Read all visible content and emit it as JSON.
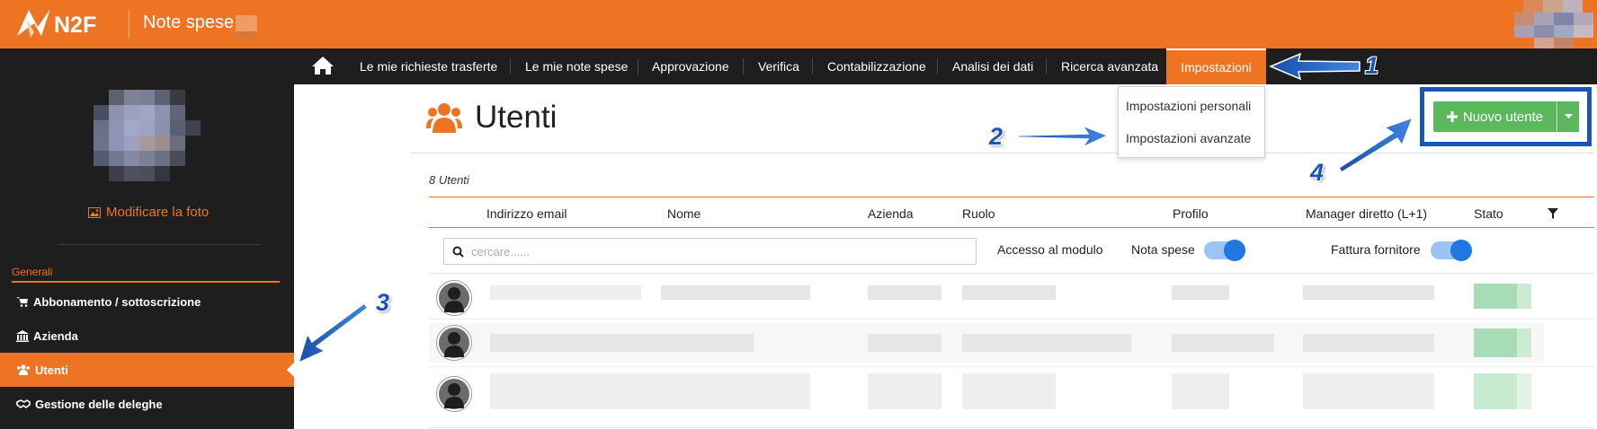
{
  "header": {
    "logo_text": "N2F",
    "app_title": "Note spese",
    "brand_color": "#ee7424"
  },
  "nav": {
    "home_icon": "home-icon",
    "items": [
      "Le mie richieste trasferte",
      "Le mie note spese",
      "Approvazione",
      "Verifica",
      "Contabilizzazione",
      "Analisi dei dati",
      "Ricerca avanzata",
      "Impostazioni"
    ],
    "active": "Impostazioni"
  },
  "settings_dropdown": {
    "items": [
      "Impostazioni personali",
      "Impostazioni avanzate"
    ]
  },
  "sidebar": {
    "change_photo": "Modificare la foto",
    "section": "Generali",
    "items": [
      {
        "label": "Abbonamento / sottoscrizione",
        "icon": "cart-icon"
      },
      {
        "label": "Azienda",
        "icon": "bank-icon"
      },
      {
        "label": "Utenti",
        "icon": "users-icon",
        "active": true
      },
      {
        "label": "Gestione delle deleghe",
        "icon": "handshake-icon"
      }
    ]
  },
  "main": {
    "title": "Utenti",
    "count_label": "8 Utenti",
    "new_user_button": "Nuovo utente",
    "columns": [
      "Indirizzo email",
      "Nome",
      "Azienda",
      "Ruolo",
      "Profilo",
      "Manager diretto (L+1)",
      "Stato"
    ],
    "search_placeholder": "cercare......",
    "module_access_label": "Accesso al modulo",
    "filters": [
      {
        "label": "Nota spese",
        "enabled": true
      },
      {
        "label": "Fattura fornitore",
        "enabled": true
      }
    ],
    "toggle_color": "#1f78e0",
    "status_color": "#a8dcb6",
    "button_color": "#5cb85c"
  },
  "annotations": {
    "numbers": [
      "1",
      "2",
      "3",
      "4"
    ],
    "color": "#1a55b4"
  }
}
